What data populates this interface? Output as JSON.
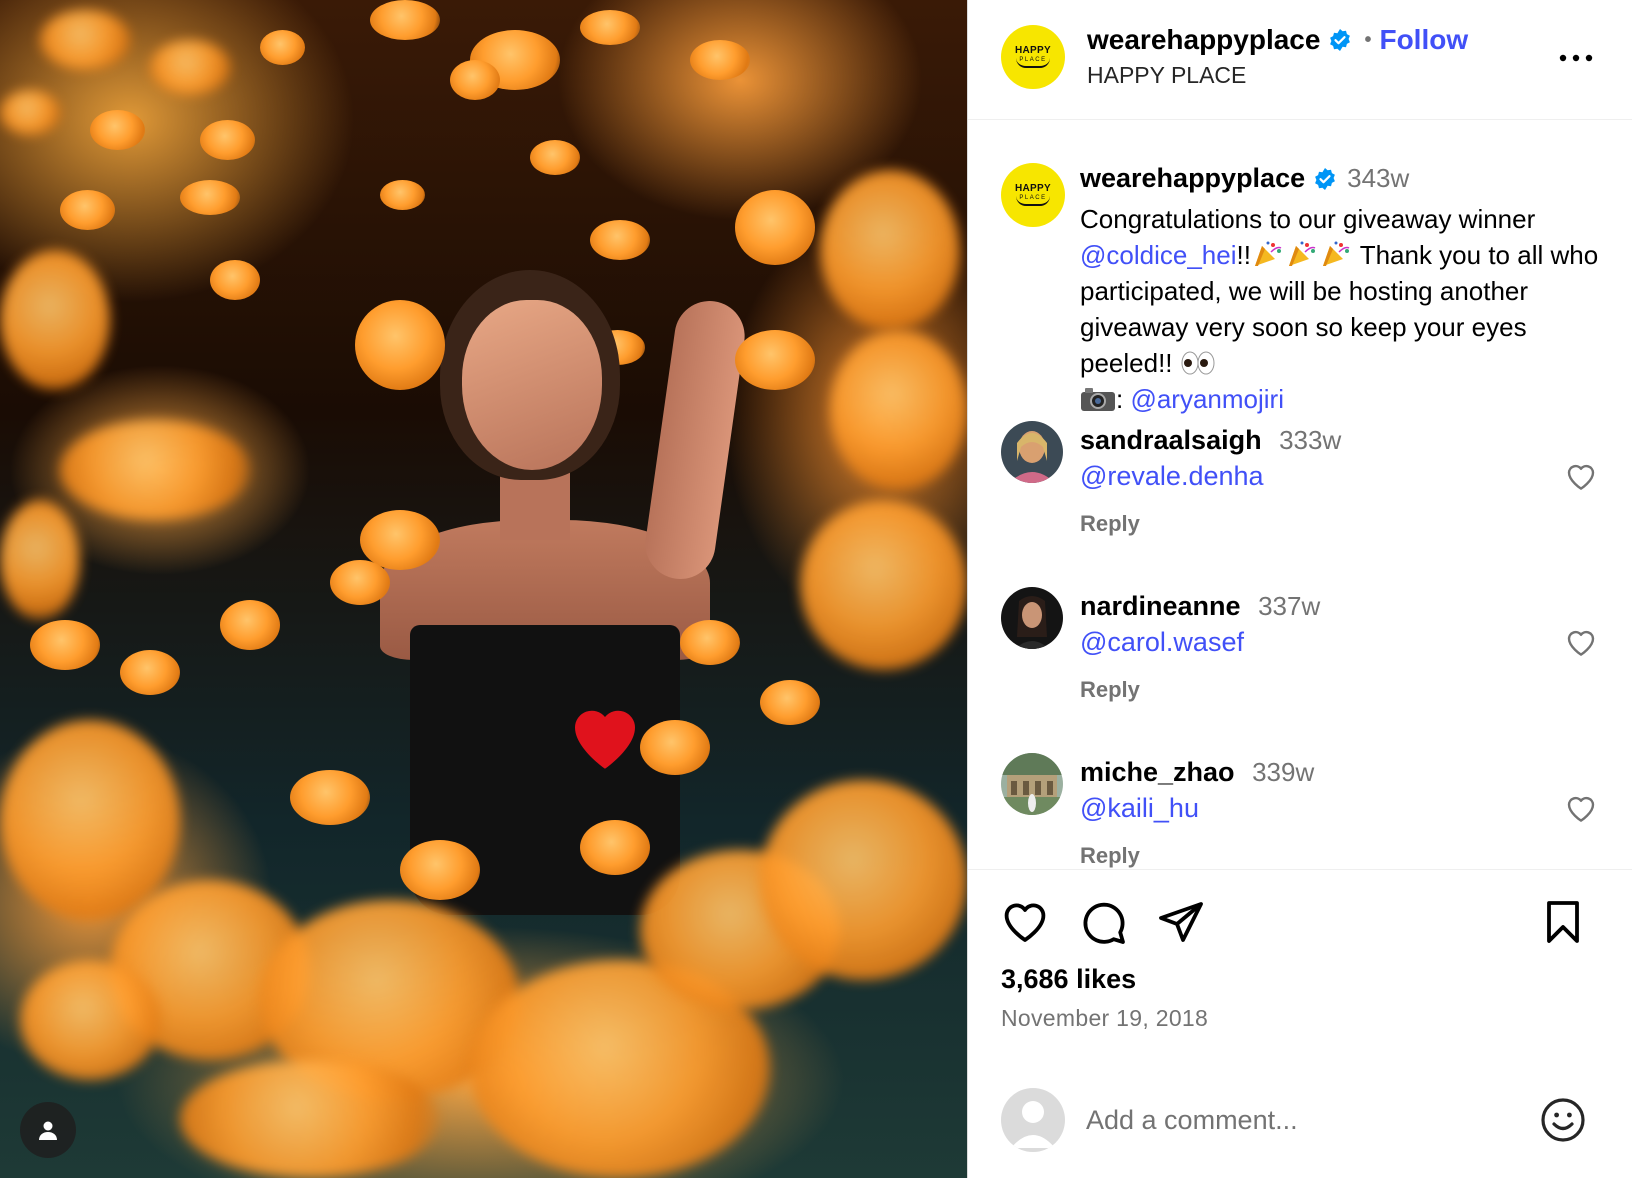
{
  "post": {
    "image_alt": "Woman in black dress among orange marigolds",
    "header": {
      "username": "wearehappyplace",
      "follow_label": "Follow",
      "subtitle": "HAPPY PLACE",
      "avatar_text_top": "HAPPY",
      "avatar_text_bottom": "PLACE"
    },
    "caption": {
      "username": "wearehappyplace",
      "time": "343w",
      "text_1": "Congratulations to our giveaway winner",
      "mention_1": "@coldice_hei",
      "text_2": "!!",
      "text_3": " Thank you to all who participated, we will be hosting another giveaway very soon so keep your eyes peeled!!",
      "text_4": ": ",
      "mention_2": "@aryanmojiri"
    },
    "comments": [
      {
        "username": "sandraalsaigh",
        "time": "333w",
        "body": "@revale.denha",
        "reply_label": "Reply"
      },
      {
        "username": "nardineanne",
        "time": "337w",
        "body": "@carol.wasef",
        "reply_label": "Reply"
      },
      {
        "username": "miche_zhao",
        "time": "339w",
        "body": "@kaili_hu",
        "reply_label": "Reply"
      }
    ],
    "likes": "3,686 likes",
    "date": "November 19, 2018",
    "add_comment_placeholder": "Add a comment..."
  },
  "colors": {
    "link": "#4150f7",
    "verified": "#0095f6",
    "muted": "#737373",
    "avatar_yellow": "#f7e600"
  },
  "icons": [
    "verified-badge-icon",
    "more-options-icon",
    "heart-icon",
    "comment-icon",
    "share-icon",
    "bookmark-icon",
    "smiley-icon",
    "user-icon",
    "party-popper-emoji",
    "eyes-emoji",
    "camera-emoji"
  ]
}
